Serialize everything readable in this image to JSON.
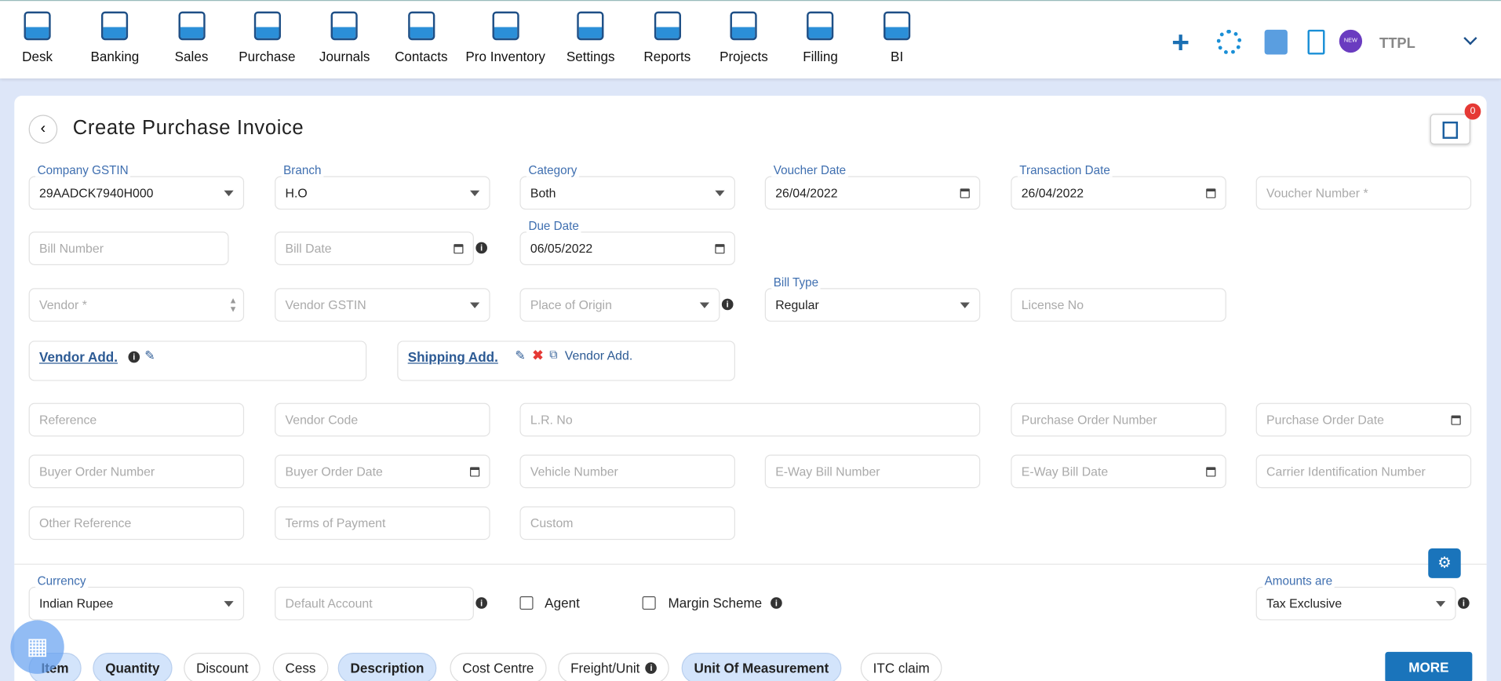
{
  "nav": [
    {
      "label": "Desk",
      "icon": "desk-icon"
    },
    {
      "label": "Banking",
      "icon": "bank-icon"
    },
    {
      "label": "Sales",
      "icon": "sales-icon"
    },
    {
      "label": "Purchase",
      "icon": "purchase-icon"
    },
    {
      "label": "Journals",
      "icon": "journals-icon"
    },
    {
      "label": "Contacts",
      "icon": "contacts-icon"
    },
    {
      "label": "Pro Inventory",
      "icon": "inventory-icon"
    },
    {
      "label": "Settings",
      "icon": "settings-icon"
    },
    {
      "label": "Reports",
      "icon": "reports-icon"
    },
    {
      "label": "Projects",
      "icon": "projects-icon"
    },
    {
      "label": "Filling",
      "icon": "filling-icon"
    },
    {
      "label": "BI",
      "icon": "bi-icon"
    }
  ],
  "header": {
    "company": "TTPL",
    "new_badge": "NEW"
  },
  "page": {
    "title": "Create Purchase Invoice",
    "notification_count": "0"
  },
  "fields": {
    "company_gstin": {
      "label": "Company GSTIN",
      "value": "29AADCK7940H000"
    },
    "branch": {
      "label": "Branch",
      "value": "H.O"
    },
    "category": {
      "label": "Category",
      "value": "Both"
    },
    "voucher_date": {
      "label": "Voucher Date",
      "value": "26/04/2022"
    },
    "transaction_date": {
      "label": "Transaction Date",
      "value": "26/04/2022"
    },
    "voucher_number": {
      "placeholder": "Voucher Number *"
    },
    "bill_number": {
      "placeholder": "Bill Number"
    },
    "bill_date": {
      "placeholder": "Bill Date"
    },
    "due_date": {
      "label": "Due Date",
      "value": "06/05/2022"
    },
    "vendor": {
      "placeholder": "Vendor *"
    },
    "vendor_gstin": {
      "placeholder": "Vendor GSTIN"
    },
    "place_of_origin": {
      "placeholder": "Place of Origin"
    },
    "bill_type": {
      "label": "Bill Type",
      "value": "Regular"
    },
    "license_no": {
      "placeholder": "License No"
    },
    "reference": {
      "placeholder": "Reference"
    },
    "vendor_code": {
      "placeholder": "Vendor Code"
    },
    "lr_no": {
      "placeholder": "L.R. No"
    },
    "po_number": {
      "placeholder": "Purchase Order Number"
    },
    "po_date": {
      "placeholder": "Purchase Order Date"
    },
    "buyer_order_number": {
      "placeholder": "Buyer Order Number"
    },
    "buyer_order_date": {
      "placeholder": "Buyer Order Date"
    },
    "vehicle_number": {
      "placeholder": "Vehicle Number"
    },
    "eway_bill_number": {
      "placeholder": "E-Way Bill Number"
    },
    "eway_bill_date": {
      "placeholder": "E-Way Bill Date"
    },
    "carrier_id": {
      "placeholder": "Carrier Identification Number"
    },
    "other_reference": {
      "placeholder": "Other Reference"
    },
    "terms_of_payment": {
      "placeholder": "Terms of Payment"
    },
    "custom": {
      "placeholder": "Custom"
    },
    "currency": {
      "label": "Currency",
      "value": "Indian Rupee"
    },
    "default_account": {
      "placeholder": "Default Account"
    },
    "amounts_are": {
      "label": "Amounts are",
      "value": "Tax Exclusive"
    }
  },
  "address": {
    "vendor": "Vendor Add.",
    "shipping": "Shipping Add.",
    "copy_vendor": "Vendor Add."
  },
  "checks": {
    "agent": "Agent",
    "margin": "Margin Scheme"
  },
  "chips": [
    {
      "label": "Item",
      "on": true
    },
    {
      "label": "Quantity",
      "on": true
    },
    {
      "label": "Discount",
      "on": false
    },
    {
      "label": "Cess",
      "on": false
    },
    {
      "label": "Description",
      "on": true
    },
    {
      "label": "Cost Centre",
      "on": false
    },
    {
      "label": "Freight/Unit",
      "on": false
    },
    {
      "label": "Unit Of Measurement",
      "on": true
    },
    {
      "label": "ITC claim",
      "on": false
    }
  ],
  "more": "MORE",
  "colors": {
    "accent": "#1a74bb",
    "label": "#3f6fb0",
    "chip_on": "#d3e4fb"
  }
}
